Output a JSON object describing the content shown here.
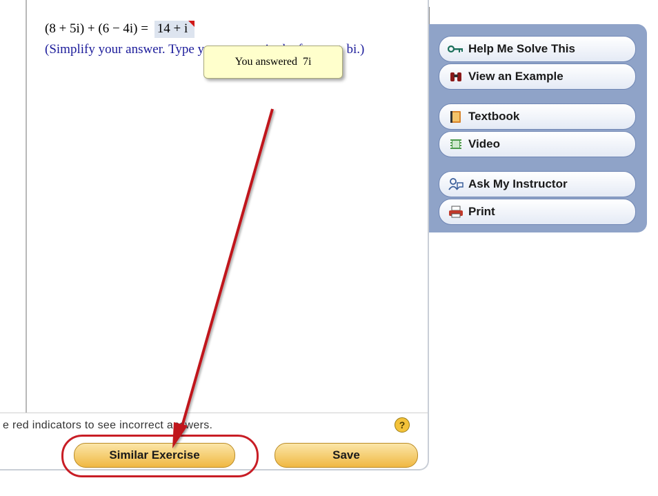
{
  "question": {
    "expression": "(8 + 5i) + (6 − 4i) =",
    "answer_input": "14 + i",
    "instruction": "(Simplify your answer. Type your answer in the form a + bi.)"
  },
  "tooltip": {
    "label": "You answered",
    "value": "7i"
  },
  "status_bar": {
    "text": "e red indicators to see incorrect answers.",
    "help_symbol": "?"
  },
  "actions": {
    "similar_exercise": "Similar Exercise",
    "save": "Save"
  },
  "sidebar": {
    "help_me_solve": {
      "label": "Help Me Solve This",
      "icon": "key-icon"
    },
    "view_example": {
      "label": "View an Example",
      "icon": "binoculars-icon"
    },
    "textbook": {
      "label": "Textbook",
      "icon": "book-icon"
    },
    "video": {
      "label": "Video",
      "icon": "film-icon"
    },
    "ask_instructor": {
      "label": "Ask My Instructor",
      "icon": "person-icon"
    },
    "print": {
      "label": "Print",
      "icon": "printer-icon"
    }
  },
  "colors": {
    "accent_red": "#c81d25",
    "button_gold": "#f0b843",
    "sidebar_blue": "#8fa3c8",
    "instruction_blue": "#1b1b9a"
  }
}
